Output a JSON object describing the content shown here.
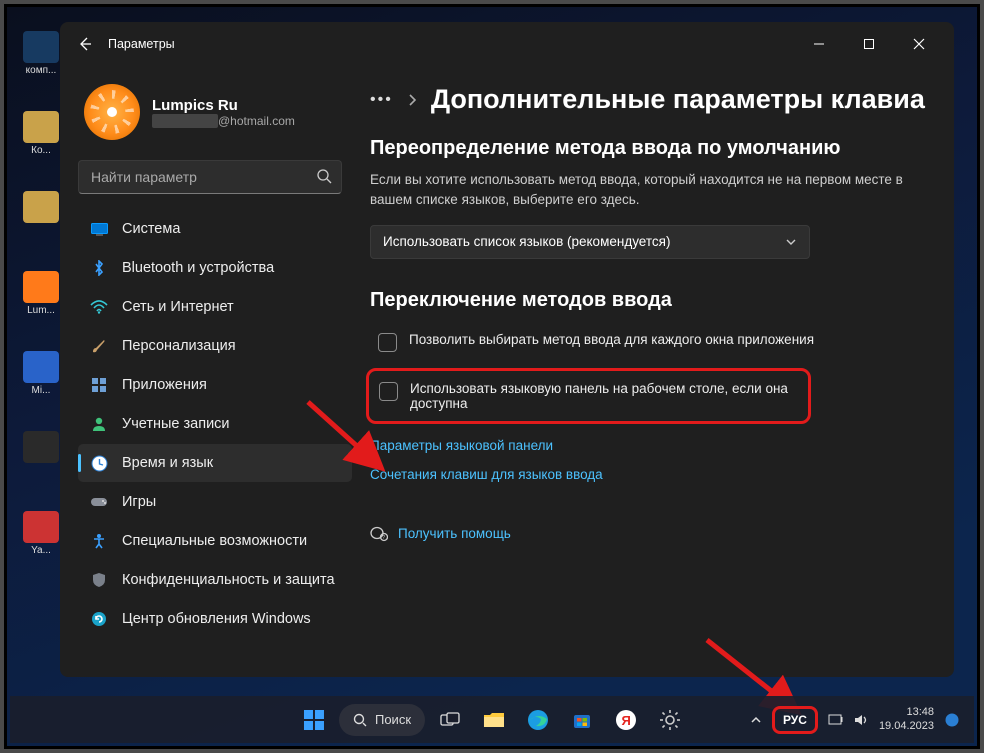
{
  "window": {
    "app_title": "Параметры"
  },
  "account": {
    "name": "Lumpics Ru",
    "email_suffix": "@hotmail.com"
  },
  "search": {
    "placeholder": "Найти параметр"
  },
  "nav": {
    "items": [
      {
        "id": "system",
        "label": "Система"
      },
      {
        "id": "bluetooth",
        "label": "Bluetooth и устройства"
      },
      {
        "id": "network",
        "label": "Сеть и Интернет"
      },
      {
        "id": "personal",
        "label": "Персонализация"
      },
      {
        "id": "apps",
        "label": "Приложения"
      },
      {
        "id": "accounts",
        "label": "Учетные записи"
      },
      {
        "id": "timelang",
        "label": "Время и язык",
        "active": true
      },
      {
        "id": "gaming",
        "label": "Игры"
      },
      {
        "id": "access",
        "label": "Специальные возможности"
      },
      {
        "id": "privacy",
        "label": "Конфиденциальность и защита"
      },
      {
        "id": "update",
        "label": "Центр обновления Windows"
      }
    ]
  },
  "breadcrumb": {
    "title": "Дополнительные параметры клавиа"
  },
  "override": {
    "heading": "Переопределение метода ввода по умолчанию",
    "desc": "Если вы хотите использовать метод ввода, который находится не на первом месте в вашем списке языков, выберите его здесь.",
    "dropdown_value": "Использовать список языков (рекомендуется)"
  },
  "switching": {
    "heading": "Переключение методов ввода",
    "checkbox1": "Позволить выбирать метод ввода для каждого окна приложения",
    "checkbox2": "Использовать языковую панель на рабочем столе, если она доступна",
    "link1": "Параметры языковой панели",
    "link2": "Сочетания клавиш для языков ввода"
  },
  "help": {
    "label": "Получить помощь"
  },
  "taskbar": {
    "search_label": "Поиск",
    "language": "РУС",
    "time": "13:48",
    "date": "19.04.2023"
  },
  "desktop_labels": [
    "комп...",
    "Ко...",
    "",
    "Lum...",
    "Mi...",
    "",
    "Ya..."
  ]
}
